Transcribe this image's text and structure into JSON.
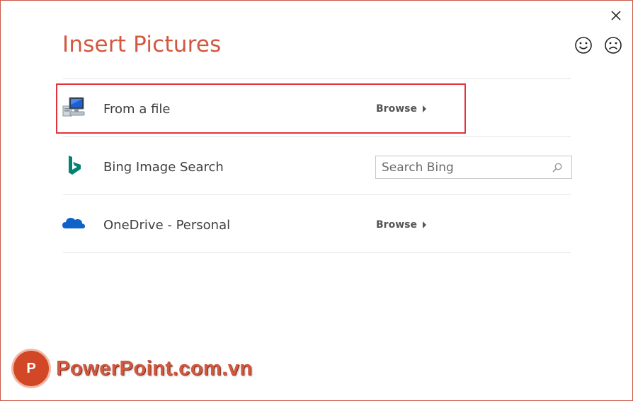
{
  "dialog": {
    "title": "Insert Pictures",
    "close_icon": "close-icon",
    "feedback": {
      "smile_icon": "smiley-face-icon",
      "frown_icon": "frowny-face-icon"
    }
  },
  "sources": {
    "file": {
      "label": "From a file",
      "action": "Browse",
      "icon": "computer-icon",
      "highlighted": true
    },
    "bing": {
      "label": "Bing Image Search",
      "search_placeholder": "Search Bing",
      "icon": "bing-logo-icon"
    },
    "onedrive": {
      "label": "OneDrive - Personal",
      "action": "Browse",
      "icon": "onedrive-cloud-icon"
    }
  },
  "watermark": {
    "logo_letter": "P",
    "text": "PowerPoint.com.vn"
  },
  "colors": {
    "accent": "#d2583f",
    "highlight": "#e0333b",
    "bing": "#008373",
    "onedrive": "#0f62c7"
  }
}
